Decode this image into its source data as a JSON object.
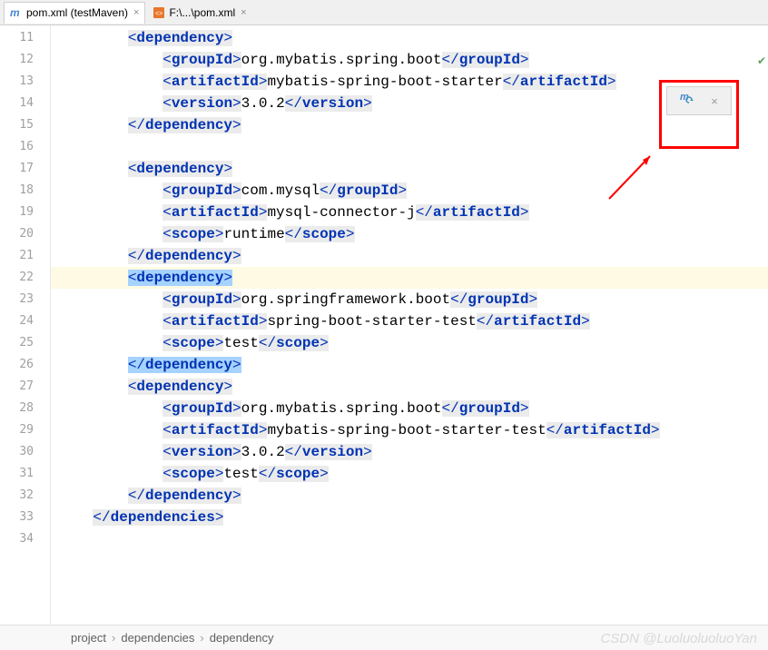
{
  "tabs": {
    "active": {
      "label": "pom.xml (testMaven)"
    },
    "other": {
      "label": "F:\\...\\pom.xml"
    }
  },
  "lines": {
    "l11": "11",
    "l12": "12",
    "l13": "13",
    "l14": "14",
    "l15": "15",
    "l16": "16",
    "l17": "17",
    "l18": "18",
    "l19": "19",
    "l20": "20",
    "l21": "21",
    "l22": "22",
    "l23": "23",
    "l24": "24",
    "l25": "25",
    "l26": "26",
    "l27": "27",
    "l28": "28",
    "l29": "29",
    "l30": "30",
    "l31": "31",
    "l32": "32",
    "l33": "33",
    "l34": "34"
  },
  "code": {
    "dependency_open": "dependency",
    "dependency_close": "dependency",
    "dependencies_close": "dependencies",
    "groupId": "groupId",
    "artifactId": "artifactId",
    "version": "version",
    "scope": "scope",
    "dep1": {
      "groupId": "org.mybatis.spring.boot",
      "artifactId": "mybatis-spring-boot-starter",
      "version": "3.0.2"
    },
    "dep2": {
      "groupId": "com.mysql",
      "artifactId": "mysql-connector-j",
      "scope": "runtime"
    },
    "dep3": {
      "groupId": "org.springframework.boot",
      "artifactId": "spring-boot-starter-test",
      "scope": "test"
    },
    "dep4": {
      "groupId": "org.mybatis.spring.boot",
      "artifactId": "mybatis-spring-boot-starter-test",
      "version": "3.0.2",
      "scope": "test"
    }
  },
  "breadcrumb": {
    "p1": "project",
    "p2": "dependencies",
    "p3": "dependency"
  },
  "watermark": "CSDN @LuoluoluoluoYan"
}
